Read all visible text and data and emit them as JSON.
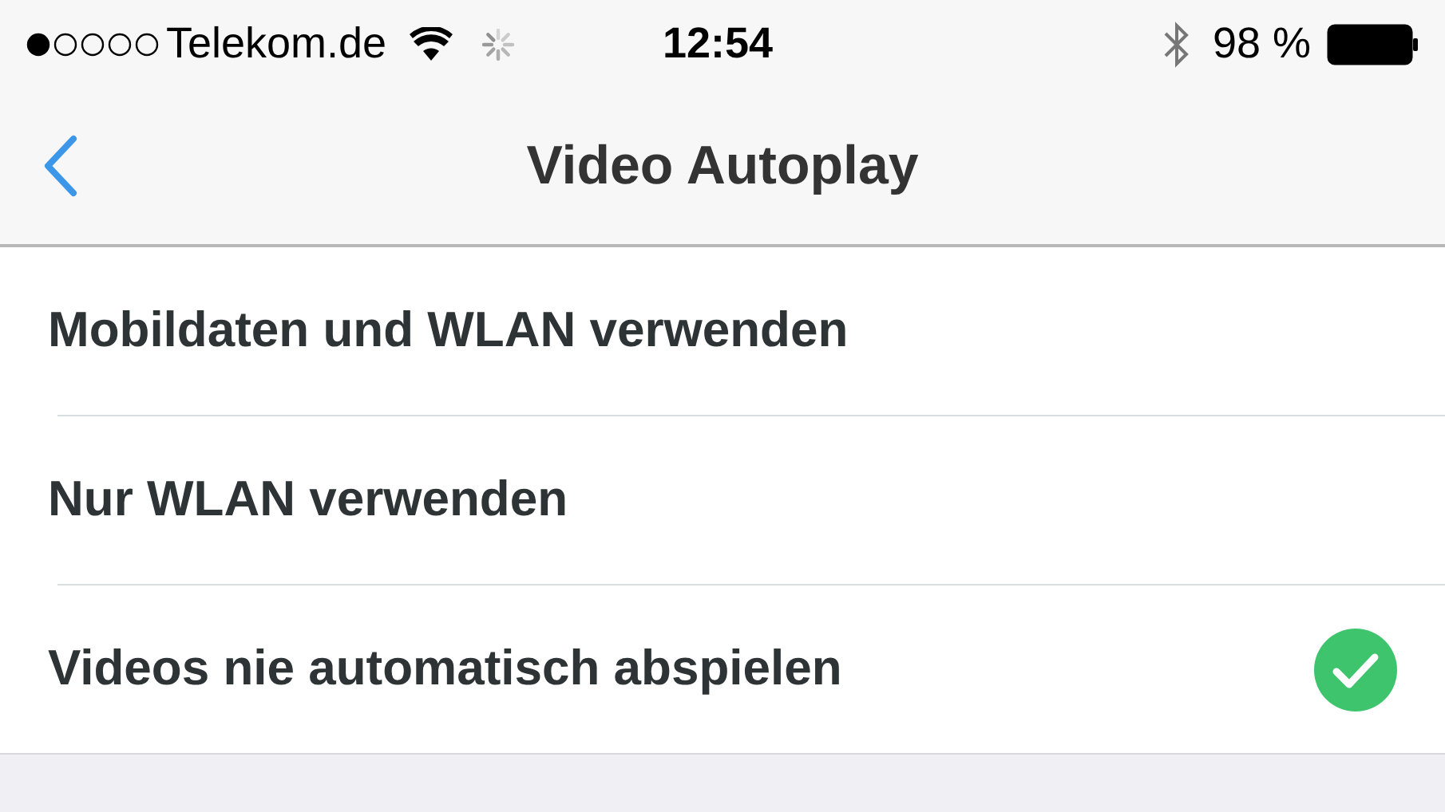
{
  "status_bar": {
    "carrier": "Telekom.de",
    "time": "12:54",
    "battery": "98 %"
  },
  "nav": {
    "title": "Video Autoplay"
  },
  "options": [
    {
      "label": "Mobildaten und WLAN verwenden",
      "selected": false
    },
    {
      "label": "Nur WLAN verwenden",
      "selected": false
    },
    {
      "label": "Videos nie automatisch abspielen",
      "selected": true
    }
  ]
}
